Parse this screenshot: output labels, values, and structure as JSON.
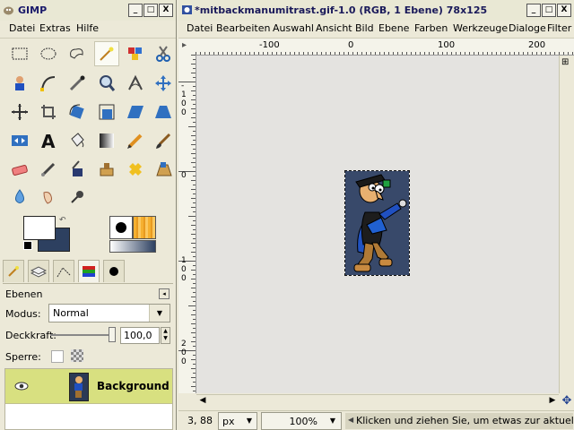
{
  "toolbox": {
    "title": "GIMP",
    "menu": [
      "Datei",
      "Extras",
      "Hilfe"
    ],
    "tools": [
      {
        "name": "rect-select-icon"
      },
      {
        "name": "ellipse-select-icon"
      },
      {
        "name": "free-select-icon"
      },
      {
        "name": "fuzzy-select-icon"
      },
      {
        "name": "color-select-icon"
      },
      {
        "name": "scissors-icon"
      },
      {
        "name": "foreground-select-icon"
      },
      {
        "name": "paths-icon"
      },
      {
        "name": "color-picker-icon"
      },
      {
        "name": "zoom-icon"
      },
      {
        "name": "measure-icon"
      },
      {
        "name": "move-icon"
      },
      {
        "name": "align-icon"
      },
      {
        "name": "crop-icon"
      },
      {
        "name": "rotate-icon"
      },
      {
        "name": "scale-icon"
      },
      {
        "name": "shear-icon"
      },
      {
        "name": "perspective-icon"
      },
      {
        "name": "flip-icon"
      },
      {
        "name": "text-icon"
      },
      {
        "name": "bucket-fill-icon"
      },
      {
        "name": "blend-icon"
      },
      {
        "name": "pencil-icon"
      },
      {
        "name": "paintbrush-icon"
      },
      {
        "name": "eraser-icon"
      },
      {
        "name": "airbrush-icon"
      },
      {
        "name": "ink-icon"
      },
      {
        "name": "clone-icon"
      },
      {
        "name": "heal-icon"
      },
      {
        "name": "perspective-clone-icon"
      },
      {
        "name": "blur-icon"
      },
      {
        "name": "smudge-icon"
      },
      {
        "name": "dodge-burn-icon"
      }
    ],
    "layers_title": "Ebenen",
    "mode_label": "Modus:",
    "mode_value": "Normal",
    "opacity_label": "Deckkraft:",
    "opacity_value": "100,0",
    "lock_label": "Sperre:",
    "layer_name": "Background",
    "colors": {
      "fg": "#ffffff",
      "bg": "#2d4060",
      "accent": "#d8e080"
    }
  },
  "image_window": {
    "title": "*mitbackmanumitrast.gif-1.0 (RGB, 1 Ebene) 78x125",
    "menu": [
      "Datei",
      "Bearbeiten",
      "Auswahl",
      "Ansicht",
      "Bild",
      "Ebene",
      "Farben",
      "Werkzeuge",
      "Dialoge",
      "Filter"
    ],
    "ruler_h": [
      "-100",
      "0",
      "100",
      "200"
    ],
    "ruler_v": [
      "-100",
      "0",
      "100",
      "200"
    ],
    "coords": "3, 88",
    "unit": "px",
    "zoom": "100%",
    "status": "Klicken und ziehen Sie, um etwas zur aktuellen Auswahl..."
  },
  "window_buttons": [
    "_",
    "□",
    "X"
  ]
}
